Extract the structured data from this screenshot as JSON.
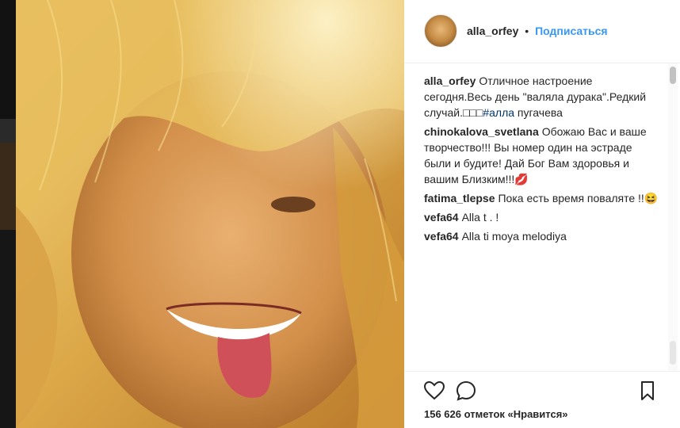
{
  "post": {
    "image_alt": "selfie photo",
    "author": "alla_orfey",
    "follow_label": "Подписаться",
    "separator": "•"
  },
  "comments": [
    {
      "author": "alla_orfey",
      "text": "Отличное настроение сегодня.Весь день \"валяла дурака\".Редкий случай.□□□",
      "tag": "#алла",
      "tail": " пугачева"
    },
    {
      "author": "chinokalova_svetlana",
      "text": "Обожаю Вас и ваше творчество!!! Вы номер один на эстраде были и будите! Дай Бог Вам здоровья и вашим Близким!!!💋"
    },
    {
      "author": "fatima_tlepse",
      "text": "Пока есть время поваляте !!😆"
    },
    {
      "author": "vefa64",
      "text": "Alla t . !"
    },
    {
      "author": "vefa64",
      "text": "Alla ti moya melodiya"
    }
  ],
  "actions": {
    "like_icon": "heart-icon",
    "comment_icon": "comment-icon",
    "save_icon": "bookmark-icon",
    "likes_text": "156 626 отметок «Нравится»"
  },
  "colors": {
    "link": "#3897f0",
    "text": "#262626",
    "border": "#efefef"
  }
}
